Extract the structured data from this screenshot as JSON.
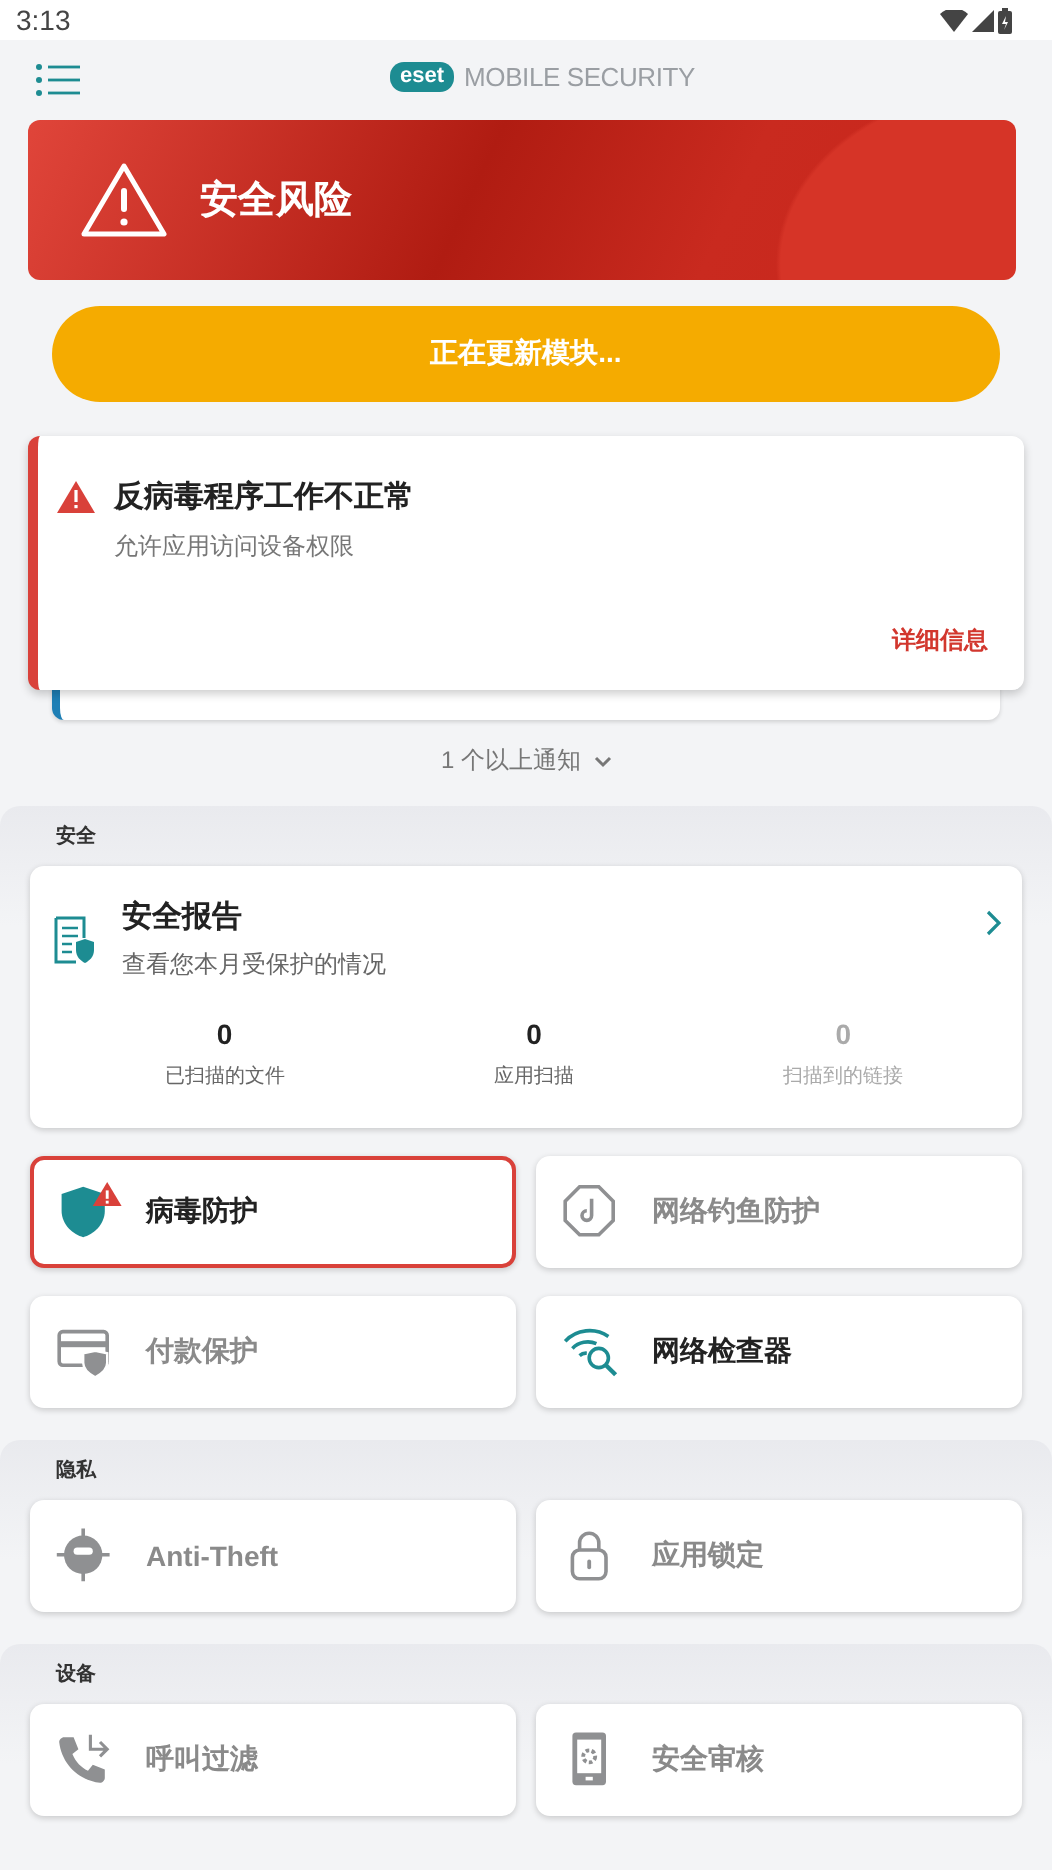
{
  "status_bar": {
    "time": "3:13"
  },
  "header": {
    "logo_badge": "eset",
    "title": "MOBILE SECURITY"
  },
  "risk_banner": {
    "title": "安全风险"
  },
  "update_button": {
    "label": "正在更新模块..."
  },
  "notification": {
    "title": "反病毒程序工作不正常",
    "message": "允许应用访问设备权限",
    "link": "详细信息"
  },
  "more_notifications": {
    "label": "1 个以上通知"
  },
  "sections": [
    {
      "title": "安全",
      "report": {
        "title": "安全报告",
        "subtitle": "查看您本月受保护的情况",
        "stats": [
          {
            "value": "0",
            "label": "已扫描的文件",
            "active": true
          },
          {
            "value": "0",
            "label": "应用扫描",
            "active": true
          },
          {
            "value": "0",
            "label": "扫描到的链接",
            "active": false
          }
        ]
      },
      "tiles": [
        {
          "kind": "shield",
          "label": "病毒防护",
          "active": true,
          "alert": true
        },
        {
          "kind": "phishing",
          "label": "网络钓鱼防护",
          "active": false,
          "alert": false
        },
        {
          "kind": "payment",
          "label": "付款保护",
          "active": false,
          "alert": false
        },
        {
          "kind": "network",
          "label": "网络检查器",
          "active": true,
          "alert": false
        }
      ]
    },
    {
      "title": "隐私",
      "tiles": [
        {
          "kind": "antitheft",
          "label": "Anti-Theft",
          "active": false,
          "alert": false
        },
        {
          "kind": "lock",
          "label": "应用锁定",
          "active": false,
          "alert": false
        }
      ]
    },
    {
      "title": "设备",
      "tiles": [
        {
          "kind": "call",
          "label": "呼叫过滤",
          "active": false,
          "alert": false
        },
        {
          "kind": "audit",
          "label": "安全审核",
          "active": false,
          "alert": false
        }
      ]
    }
  ]
}
